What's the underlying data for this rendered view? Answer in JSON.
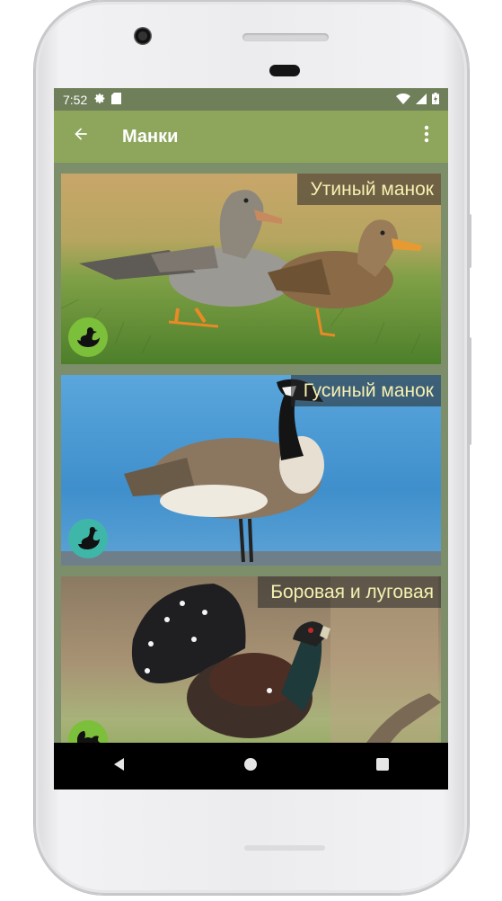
{
  "status_bar": {
    "time": "7:52",
    "icons": [
      "settings-icon",
      "sd-card-icon",
      "wifi-icon",
      "signal-icon",
      "battery-icon"
    ]
  },
  "app_bar": {
    "back_icon": "arrow-back-icon",
    "title": "Манки",
    "menu_icon": "more-vert-icon"
  },
  "cards": [
    {
      "label": "Утиный манок",
      "image": "two ducks standing on grass",
      "avatar": "duck-icon",
      "avatar_color": "#7cbf3a"
    },
    {
      "label": "Гусиный манок",
      "image": "canada goose standing by blue water",
      "avatar": "goose-icon",
      "avatar_color": "#3fb7a8"
    },
    {
      "label": "Боровая и луговая",
      "image": "capercaillie with spread tail",
      "avatar": "grouse-icon",
      "avatar_color": "#7cbf3a"
    }
  ],
  "nav_bar": {
    "back": "nav-back-icon",
    "home": "nav-home-icon",
    "recents": "nav-recents-icon"
  },
  "colors": {
    "status_bar": "#6f7f59",
    "app_bar": "#8ea65c",
    "list_background": "#7d8f6a",
    "badge_text": "#f5f0b0"
  }
}
